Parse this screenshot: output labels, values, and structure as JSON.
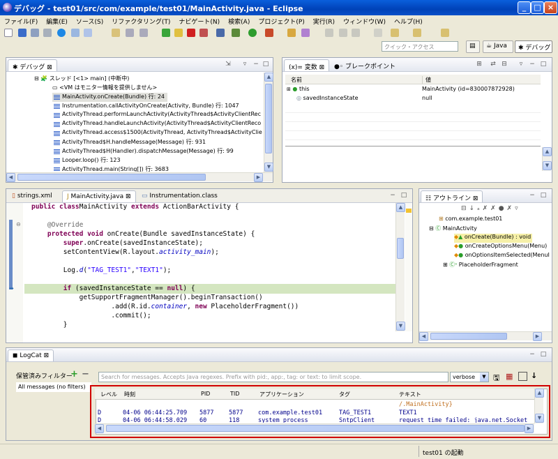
{
  "window": {
    "title": "デバッグ - test01/src/com/example/test01/MainActivity.java - Eclipse"
  },
  "menu": [
    "ファイル(F)",
    "編集(E)",
    "ソース(S)",
    "リファクタリング(T)",
    "ナビゲート(N)",
    "検索(A)",
    "プロジェクト(P)",
    "実行(R)",
    "ウィンドウ(W)",
    "ヘルプ(H)"
  ],
  "quick_access_placeholder": "クイック・アクセス",
  "perspectives": {
    "java": "Java",
    "debug": "デバッグ"
  },
  "debug_view": {
    "tab": "デバッグ",
    "thread": "スレッド [<1> main] (中断中)",
    "vm_note": "<VM はモニター情報を提供しません>",
    "frames": [
      "MainActivity.onCreate(Bundle) 行: 24",
      "Instrumentation.callActivityOnCreate(Activity, Bundle) 行: 1047",
      "ActivityThread.performLaunchActivity(ActivityThread$ActivityClientRec",
      "ActivityThread.handleLaunchActivity(ActivityThread$ActivityClientReco",
      "ActivityThread.access$1500(ActivityThread, ActivityThread$ActivityClie",
      "ActivityThread$H.handleMessage(Message) 行: 931",
      "ActivityThread$H(Handler).dispatchMessage(Message) 行: 99",
      "Looper.loop() 行: 123",
      "ActivityThread.main(String[]) 行: 3683"
    ]
  },
  "variables_view": {
    "tab_variables": "変数",
    "tab_breakpoints": "ブレークポイント",
    "col_name": "名前",
    "col_value": "値",
    "rows": [
      {
        "name": "this",
        "value": "MainActivity  (id=830007872928)"
      },
      {
        "name": "savedInstanceState",
        "value": "null"
      }
    ]
  },
  "editor": {
    "tabs": [
      "strings.xml",
      "MainActivity.java",
      "Instrumentation.class"
    ],
    "lines": [
      {
        "parts": [
          [
            "kw",
            "public class"
          ],
          [
            "",
            "MainActivity "
          ],
          [
            "kw",
            "extends"
          ],
          [
            "",
            " ActionBarActivity {"
          ]
        ]
      },
      {
        "parts": [
          [
            "",
            ""
          ]
        ]
      },
      {
        "parts": [
          [
            "ann",
            "    @Override"
          ]
        ]
      },
      {
        "parts": [
          [
            "kw",
            "    protected void"
          ],
          [
            "",
            " onCreate(Bundle savedInstanceState) {"
          ]
        ]
      },
      {
        "parts": [
          [
            "kw",
            "        super"
          ],
          [
            "",
            ".onCreate(savedInstanceState);"
          ]
        ]
      },
      {
        "parts": [
          [
            "",
            "        setContentView(R.layout."
          ],
          [
            "it",
            "activity_main"
          ],
          [
            "",
            ");"
          ]
        ]
      },
      {
        "parts": [
          [
            "",
            ""
          ]
        ]
      },
      {
        "parts": [
          [
            "",
            "        Log."
          ],
          [
            "it",
            "d"
          ],
          [
            "",
            "("
          ],
          [
            "str",
            "\"TAG_TEST1\""
          ],
          [
            "",
            ","
          ],
          [
            "str",
            "\"TEXT1\""
          ],
          [
            "",
            ");"
          ]
        ]
      },
      {
        "parts": [
          [
            "",
            ""
          ]
        ]
      },
      {
        "parts": [
          [
            "kw",
            "        if"
          ],
          [
            "",
            " (savedInstanceState == "
          ],
          [
            "kw",
            "null"
          ],
          [
            "",
            ") {"
          ]
        ]
      },
      {
        "parts": [
          [
            "",
            "            getSupportFragmentManager().beginTransaction()"
          ]
        ]
      },
      {
        "parts": [
          [
            "",
            "                    .add(R.id."
          ],
          [
            "it",
            "container"
          ],
          [
            "",
            ", "
          ],
          [
            "kw",
            "new"
          ],
          [
            "",
            " PlaceholderFragment())"
          ]
        ]
      },
      {
        "parts": [
          [
            "",
            "                    .commit();"
          ]
        ]
      },
      {
        "parts": [
          [
            "",
            "        }"
          ]
        ]
      }
    ]
  },
  "outline": {
    "tab": "アウトライン",
    "items": [
      "com.example.test01",
      "MainActivity",
      "onCreate(Bundle) : void",
      "onCreateOptionsMenu(Menu)",
      "onOptionsItemSelected(MenuI",
      "PlaceholderFragment"
    ]
  },
  "logcat": {
    "tab": "LogCat",
    "saved_filters": "保管済みフィルター",
    "all_messages": "All messages (no filters)",
    "search_placeholder": "Search for messages. Accepts Java regexes. Prefix with pid:, app:, tag: or text: to limit scope.",
    "level": "verbose",
    "columns": [
      "レベル",
      "時刻",
      "PID",
      "TID",
      "アプリケーション",
      "タグ",
      "テキスト"
    ],
    "rows": [
      {
        "level": "",
        "time": "",
        "pid": "",
        "tid": "",
        "app": "",
        "tag": "",
        "text": "/.MainActivity}"
      },
      {
        "level": "D",
        "time": "04-06 06:44:25.709",
        "pid": "5877",
        "tid": "5877",
        "app": "com.example.test01",
        "tag": "TAG_TEST1",
        "text": "TEXT1"
      },
      {
        "level": "D",
        "time": "04-06 06:44:58.029",
        "pid": "60",
        "tid": "118",
        "app": "system_process",
        "tag": "SntpClient",
        "text": "request time failed: java.net.Socket"
      }
    ]
  },
  "status": "test01 の起動"
}
